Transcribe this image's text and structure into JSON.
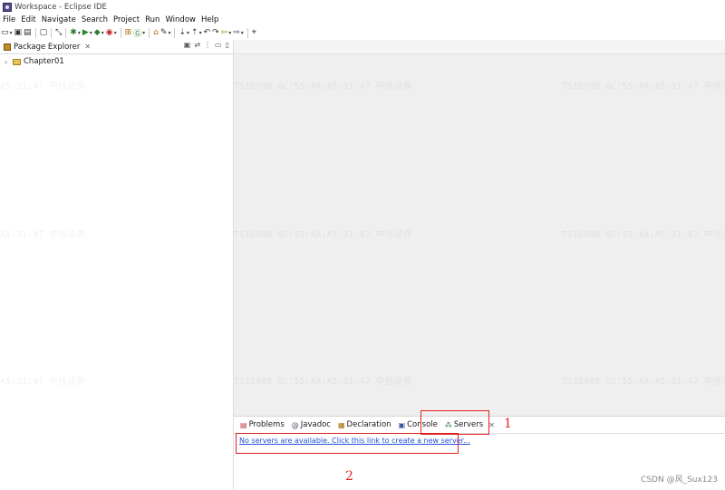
{
  "window": {
    "title": "Workspace - Eclipse IDE"
  },
  "menubar": {
    "items": [
      "File",
      "Edit",
      "Navigate",
      "Search",
      "Project",
      "Run",
      "Window",
      "Help"
    ]
  },
  "left_view": {
    "tab_label": "Package Explorer",
    "tab_close": "✕",
    "tree": [
      {
        "label": "Chapter01",
        "twisty": "›"
      }
    ]
  },
  "bottom_panel": {
    "tabs": [
      {
        "label": "Problems",
        "icon": "problems-icon"
      },
      {
        "label": "Javadoc",
        "icon": "javadoc-icon"
      },
      {
        "label": "Declaration",
        "icon": "declaration-icon"
      },
      {
        "label": "Console",
        "icon": "console-icon"
      },
      {
        "label": "Servers",
        "icon": "servers-icon",
        "close": "✕"
      }
    ],
    "servers_message": "No servers are available. Click this link to create a new server..."
  },
  "annotations": {
    "one": "1",
    "two": "2"
  },
  "watermark": {
    "text_a": "TS18908  6C:55:4A:A5:31:47  中信证券",
    "text_b": "A5:31:47  中信证券"
  },
  "credit": "CSDN @风_Sux123",
  "colors": {
    "annotation": "#e02020",
    "link": "#1f4fd6"
  }
}
